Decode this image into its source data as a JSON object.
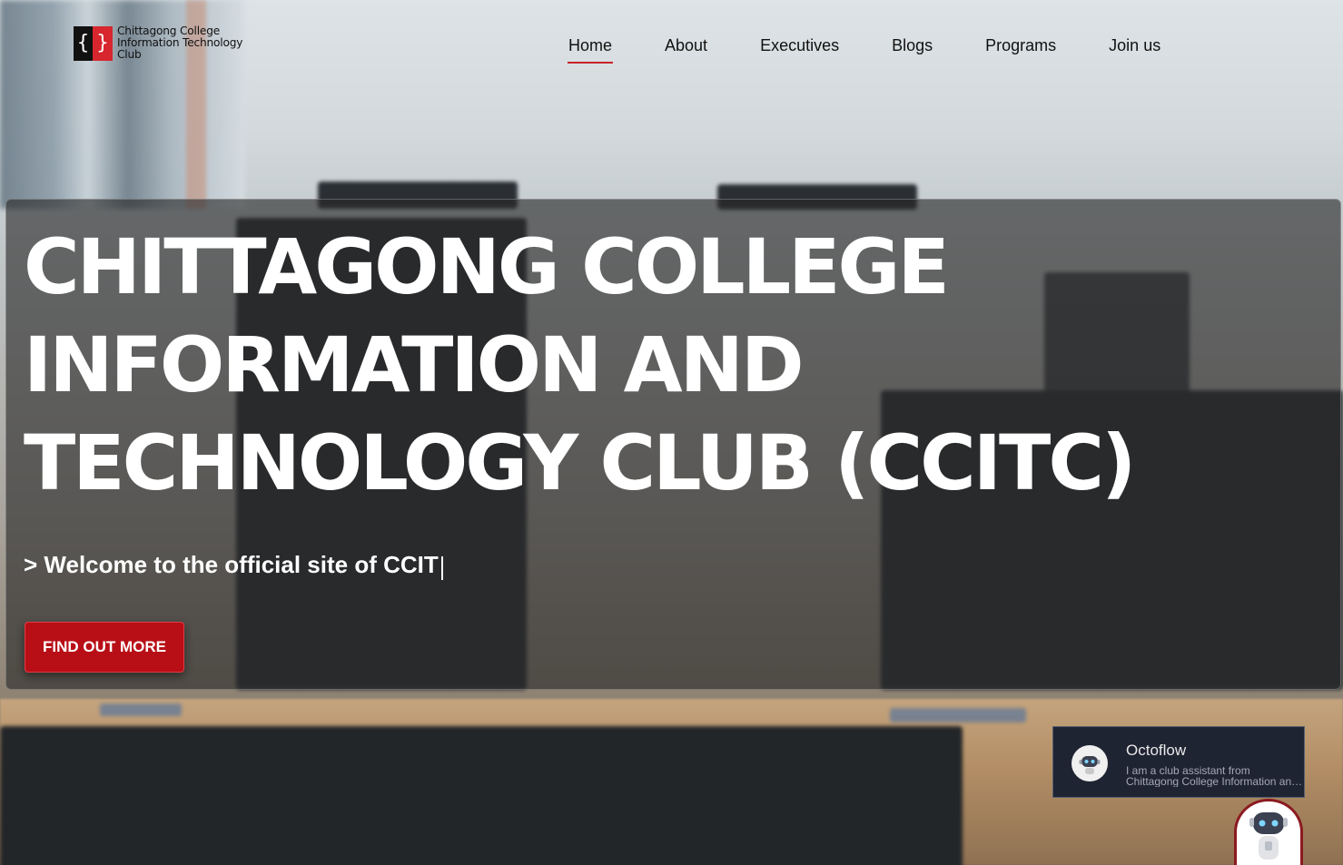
{
  "logo": {
    "mark_left": "{",
    "mark_right": "}",
    "lines": [
      "Chittagong College",
      "Information Technology",
      "Club"
    ]
  },
  "nav": {
    "items": [
      {
        "label": "Home",
        "active": true
      },
      {
        "label": "About"
      },
      {
        "label": "Executives"
      },
      {
        "label": "Blogs"
      },
      {
        "label": "Programs"
      },
      {
        "label": "Join us"
      }
    ]
  },
  "hero": {
    "title": "CHITTAGONG COLLEGE INFORMATION AND TECHNOLOGY CLUB (CCITC)",
    "subtitle": "> Welcome to the official site of CCIT",
    "cta_label": "FIND OUT MORE"
  },
  "chatbot": {
    "name": "Octoflow",
    "message_line1": "I am a club assistant from",
    "message_line2": "Chittagong College Information and..."
  },
  "colors": {
    "accent": "#b80f17",
    "active_underline": "#c8232b",
    "chat_bg": "#1f2433"
  }
}
